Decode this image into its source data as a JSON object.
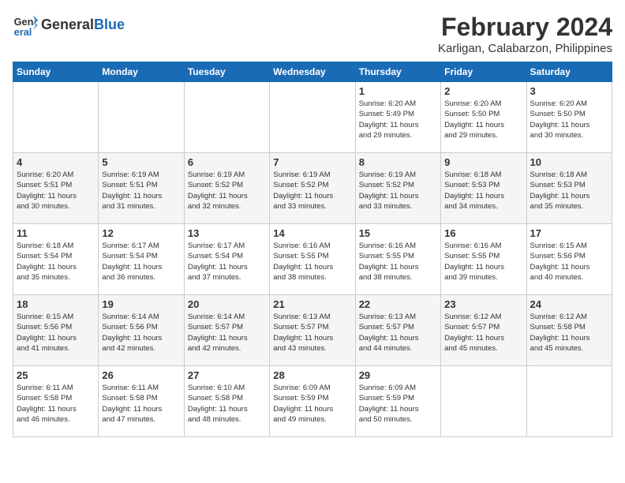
{
  "header": {
    "logo_line1": "General",
    "logo_line2": "Blue",
    "month_year": "February 2024",
    "location": "Karligan, Calabarzon, Philippines"
  },
  "days_of_week": [
    "Sunday",
    "Monday",
    "Tuesday",
    "Wednesday",
    "Thursday",
    "Friday",
    "Saturday"
  ],
  "weeks": [
    [
      {
        "day": "",
        "info": ""
      },
      {
        "day": "",
        "info": ""
      },
      {
        "day": "",
        "info": ""
      },
      {
        "day": "",
        "info": ""
      },
      {
        "day": "1",
        "info": "Sunrise: 6:20 AM\nSunset: 5:49 PM\nDaylight: 11 hours\nand 29 minutes."
      },
      {
        "day": "2",
        "info": "Sunrise: 6:20 AM\nSunset: 5:50 PM\nDaylight: 11 hours\nand 29 minutes."
      },
      {
        "day": "3",
        "info": "Sunrise: 6:20 AM\nSunset: 5:50 PM\nDaylight: 11 hours\nand 30 minutes."
      }
    ],
    [
      {
        "day": "4",
        "info": "Sunrise: 6:20 AM\nSunset: 5:51 PM\nDaylight: 11 hours\nand 30 minutes."
      },
      {
        "day": "5",
        "info": "Sunrise: 6:19 AM\nSunset: 5:51 PM\nDaylight: 11 hours\nand 31 minutes."
      },
      {
        "day": "6",
        "info": "Sunrise: 6:19 AM\nSunset: 5:52 PM\nDaylight: 11 hours\nand 32 minutes."
      },
      {
        "day": "7",
        "info": "Sunrise: 6:19 AM\nSunset: 5:52 PM\nDaylight: 11 hours\nand 33 minutes."
      },
      {
        "day": "8",
        "info": "Sunrise: 6:19 AM\nSunset: 5:52 PM\nDaylight: 11 hours\nand 33 minutes."
      },
      {
        "day": "9",
        "info": "Sunrise: 6:18 AM\nSunset: 5:53 PM\nDaylight: 11 hours\nand 34 minutes."
      },
      {
        "day": "10",
        "info": "Sunrise: 6:18 AM\nSunset: 5:53 PM\nDaylight: 11 hours\nand 35 minutes."
      }
    ],
    [
      {
        "day": "11",
        "info": "Sunrise: 6:18 AM\nSunset: 5:54 PM\nDaylight: 11 hours\nand 35 minutes."
      },
      {
        "day": "12",
        "info": "Sunrise: 6:17 AM\nSunset: 5:54 PM\nDaylight: 11 hours\nand 36 minutes."
      },
      {
        "day": "13",
        "info": "Sunrise: 6:17 AM\nSunset: 5:54 PM\nDaylight: 11 hours\nand 37 minutes."
      },
      {
        "day": "14",
        "info": "Sunrise: 6:16 AM\nSunset: 5:55 PM\nDaylight: 11 hours\nand 38 minutes."
      },
      {
        "day": "15",
        "info": "Sunrise: 6:16 AM\nSunset: 5:55 PM\nDaylight: 11 hours\nand 38 minutes."
      },
      {
        "day": "16",
        "info": "Sunrise: 6:16 AM\nSunset: 5:55 PM\nDaylight: 11 hours\nand 39 minutes."
      },
      {
        "day": "17",
        "info": "Sunrise: 6:15 AM\nSunset: 5:56 PM\nDaylight: 11 hours\nand 40 minutes."
      }
    ],
    [
      {
        "day": "18",
        "info": "Sunrise: 6:15 AM\nSunset: 5:56 PM\nDaylight: 11 hours\nand 41 minutes."
      },
      {
        "day": "19",
        "info": "Sunrise: 6:14 AM\nSunset: 5:56 PM\nDaylight: 11 hours\nand 42 minutes."
      },
      {
        "day": "20",
        "info": "Sunrise: 6:14 AM\nSunset: 5:57 PM\nDaylight: 11 hours\nand 42 minutes."
      },
      {
        "day": "21",
        "info": "Sunrise: 6:13 AM\nSunset: 5:57 PM\nDaylight: 11 hours\nand 43 minutes."
      },
      {
        "day": "22",
        "info": "Sunrise: 6:13 AM\nSunset: 5:57 PM\nDaylight: 11 hours\nand 44 minutes."
      },
      {
        "day": "23",
        "info": "Sunrise: 6:12 AM\nSunset: 5:57 PM\nDaylight: 11 hours\nand 45 minutes."
      },
      {
        "day": "24",
        "info": "Sunrise: 6:12 AM\nSunset: 5:58 PM\nDaylight: 11 hours\nand 45 minutes."
      }
    ],
    [
      {
        "day": "25",
        "info": "Sunrise: 6:11 AM\nSunset: 5:58 PM\nDaylight: 11 hours\nand 46 minutes."
      },
      {
        "day": "26",
        "info": "Sunrise: 6:11 AM\nSunset: 5:58 PM\nDaylight: 11 hours\nand 47 minutes."
      },
      {
        "day": "27",
        "info": "Sunrise: 6:10 AM\nSunset: 5:58 PM\nDaylight: 11 hours\nand 48 minutes."
      },
      {
        "day": "28",
        "info": "Sunrise: 6:09 AM\nSunset: 5:59 PM\nDaylight: 11 hours\nand 49 minutes."
      },
      {
        "day": "29",
        "info": "Sunrise: 6:09 AM\nSunset: 5:59 PM\nDaylight: 11 hours\nand 50 minutes."
      },
      {
        "day": "",
        "info": ""
      },
      {
        "day": "",
        "info": ""
      }
    ]
  ]
}
